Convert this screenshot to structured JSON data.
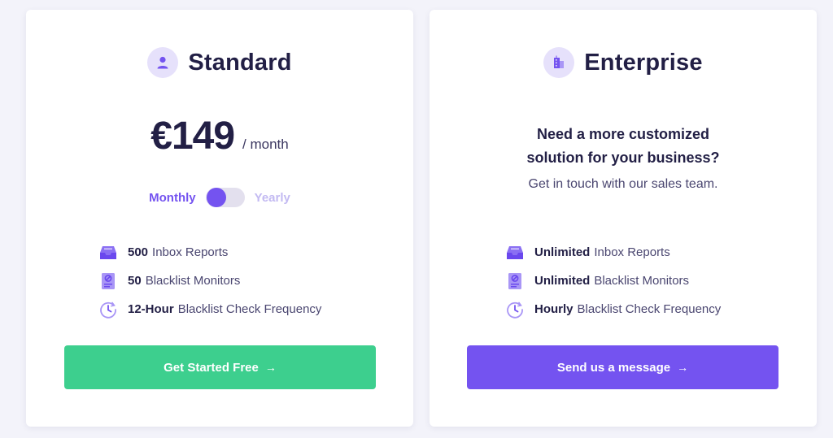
{
  "colors": {
    "accent_purple": "#7453f0",
    "accent_green": "#3dcf8e",
    "icon_bg": "#e6e1fb",
    "heading": "#221f45"
  },
  "standard": {
    "icon": "user-icon",
    "title": "Standard",
    "price": "€149",
    "period": "/  month",
    "toggle": {
      "monthly_label": "Monthly",
      "yearly_label": "Yearly",
      "selected": "Monthly"
    },
    "features": [
      {
        "icon": "inbox-icon",
        "strong": "500",
        "text": "Inbox Reports"
      },
      {
        "icon": "blacklist-document-icon",
        "strong": "50",
        "text": "Blacklist Monitors"
      },
      {
        "icon": "clock-icon",
        "strong": "12-Hour",
        "text": "Blacklist Check Frequency"
      }
    ],
    "cta_label": "Get Started Free",
    "cta_arrow": "→"
  },
  "enterprise": {
    "icon": "building-icon",
    "title": "Enterprise",
    "question_line1": "Need a more customized",
    "question_line2": "solution for your business?",
    "subtext": "Get in touch with our sales team.",
    "features": [
      {
        "icon": "inbox-icon",
        "strong": "Unlimited",
        "text": "Inbox Reports"
      },
      {
        "icon": "blacklist-document-icon",
        "strong": "Unlimited",
        "text": "Blacklist Monitors"
      },
      {
        "icon": "clock-icon",
        "strong": "Hourly",
        "text": "Blacklist Check Frequency"
      }
    ],
    "cta_label": "Send us a message",
    "cta_arrow": "→"
  }
}
